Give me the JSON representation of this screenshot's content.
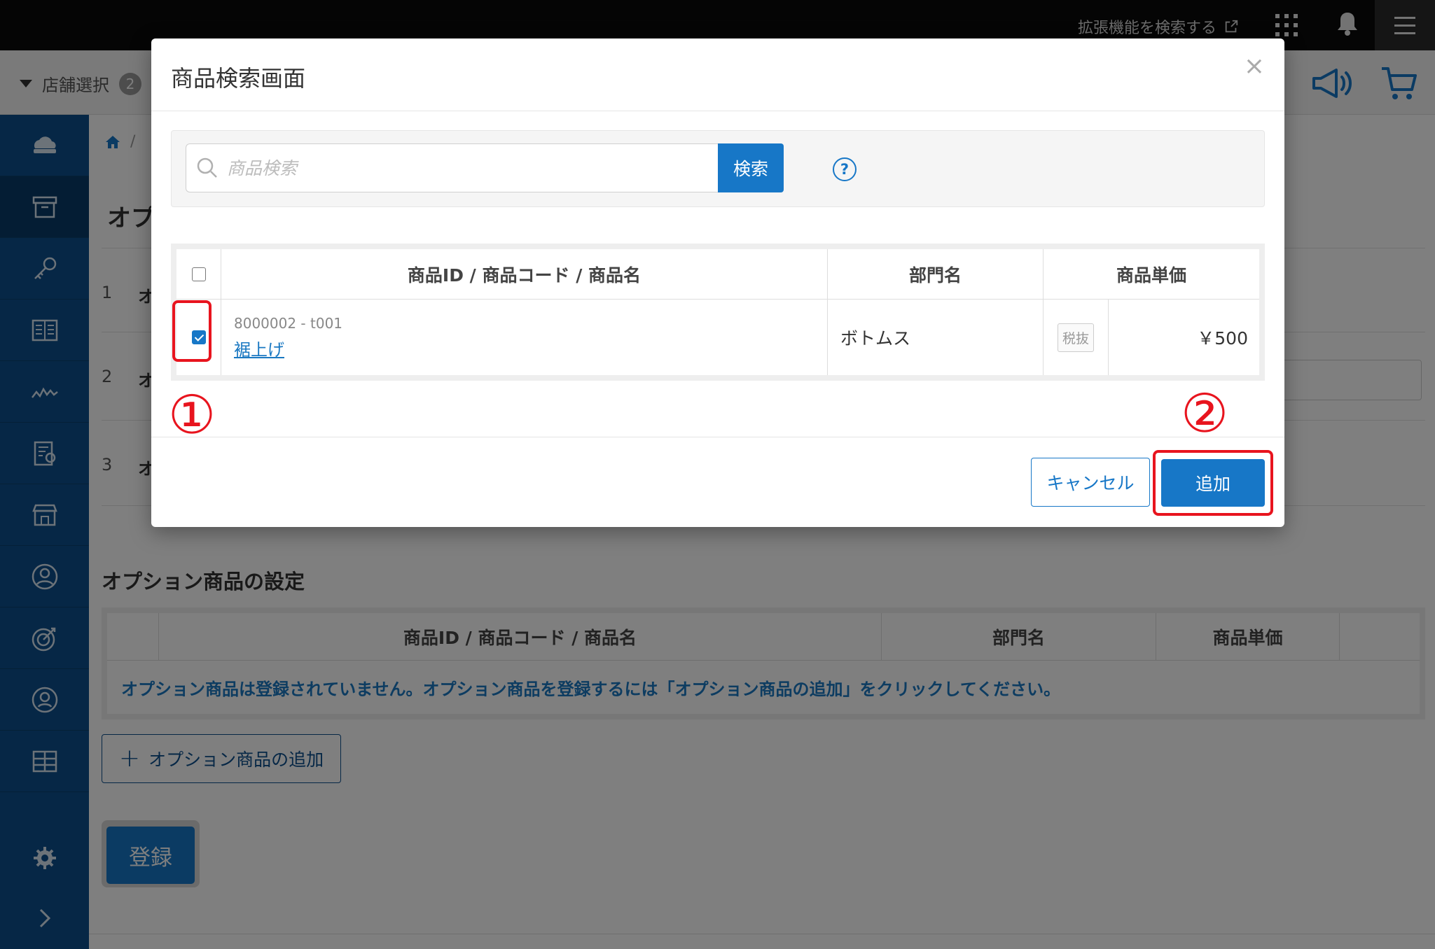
{
  "topbar": {
    "extension_search_label": "拡張機能を検索する",
    "icons": [
      "external-link-icon",
      "apps-grid-icon",
      "bell-icon",
      "hamburger-menu-icon"
    ]
  },
  "subbar": {
    "store_select_label": "店舗選択",
    "store_count": "2",
    "icons": [
      "megaphone-icon",
      "cart-icon"
    ]
  },
  "sidebar": {
    "items": [
      "cloud-icon",
      "archive-box-icon",
      "key-icon",
      "book-icon",
      "chart-line-icon",
      "report-icon",
      "store-icon",
      "user-circle-icon",
      "target-icon",
      "person-circle-icon",
      "grid-icon",
      "gear-icon",
      "chevron-right-icon"
    ]
  },
  "background": {
    "page_title_fragment": "オプ",
    "row_numbers": [
      "1",
      "2",
      "3"
    ],
    "row_label_fragment": "オ",
    "option_section_title": "オプション商品の設定",
    "option_table": {
      "columns": [
        "商品ID / 商品コード / 商品名",
        "部門名",
        "商品単価"
      ],
      "empty_message": "オプション商品は登録されていません。オプション商品を登録するには「オプション商品の追加」をクリックしてください。"
    },
    "add_option_button": "オプション商品の追加",
    "register_button": "登録"
  },
  "modal": {
    "title": "商品検索画面",
    "close_label": "×",
    "search": {
      "placeholder": "商品検索",
      "value": "",
      "button_label": "検索",
      "help_label": "?"
    },
    "table": {
      "columns": [
        "商品ID / 商品コード / 商品名",
        "部門名",
        "商品単価"
      ],
      "rows": [
        {
          "checked": true,
          "code": "8000002 - t001",
          "name": "裾上げ",
          "department": "ボトムス",
          "tax_label": "税抜",
          "price": "￥500"
        }
      ]
    },
    "cancel_button": "キャンセル",
    "add_button": "追加"
  },
  "annotations": {
    "step1": "①",
    "step2": "②",
    "color": "#e8141e"
  },
  "colors": {
    "primary": "#1777c7",
    "sidebar": "#0d4f8c",
    "topbar": "#0b0b0b",
    "link": "#1a78c2"
  }
}
